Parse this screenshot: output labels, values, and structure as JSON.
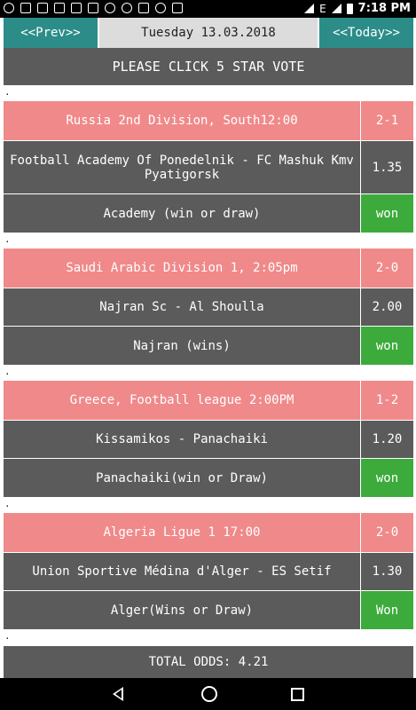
{
  "status_bar": {
    "time": "7:18",
    "ampm": "PM",
    "network": "E",
    "left_icons": [
      "opera-icon",
      "message-icon",
      "message-icon",
      "message-icon",
      "message-icon",
      "mail-icon",
      "twitter-icon",
      "whatsapp-icon",
      "pen-icon",
      "whatsapp-icon",
      "save-icon"
    ]
  },
  "nav": {
    "prev": "<<Prev>>",
    "date": "Tuesday 13.03.2018",
    "today": "<<Today>>"
  },
  "vote_banner": "PLEASE CLICK 5 STAR VOTE",
  "separator": ".",
  "matches": [
    {
      "league": "Russia 2nd Division, South12:00",
      "score": "2-1",
      "teams": "Football Academy Of Ponedelnik - FC Mashuk Kmv Pyatigorsk",
      "odds": "1.35",
      "tip": "Academy (win or draw)",
      "result": "won"
    },
    {
      "league": "Saudi Arabic Division 1, 2:05pm",
      "score": "2-0",
      "teams": "Najran Sc - Al Shoulla",
      "odds": "2.00",
      "tip": "Najran (wins)",
      "result": "won"
    },
    {
      "league": "Greece, Football league 2:00PM",
      "score": "1-2",
      "teams": "Kissamikos - Panachaiki",
      "odds": "1.20",
      "tip": "Panachaiki(win or Draw)",
      "result": "won"
    },
    {
      "league": "Algeria Ligue 1 17:00",
      "score": "2-0",
      "teams": "Union Sportive Médina d'Alger - ES Setif",
      "odds": "1.30",
      "tip": "Alger(Wins or Draw)",
      "result": "Won"
    }
  ],
  "total": "TOTAL ODDS: 4.21",
  "colors": {
    "nav_button": "#2c8c88",
    "league_row": "#f0898a",
    "row_bg": "#5b5b5b",
    "won": "#3cab3c"
  }
}
